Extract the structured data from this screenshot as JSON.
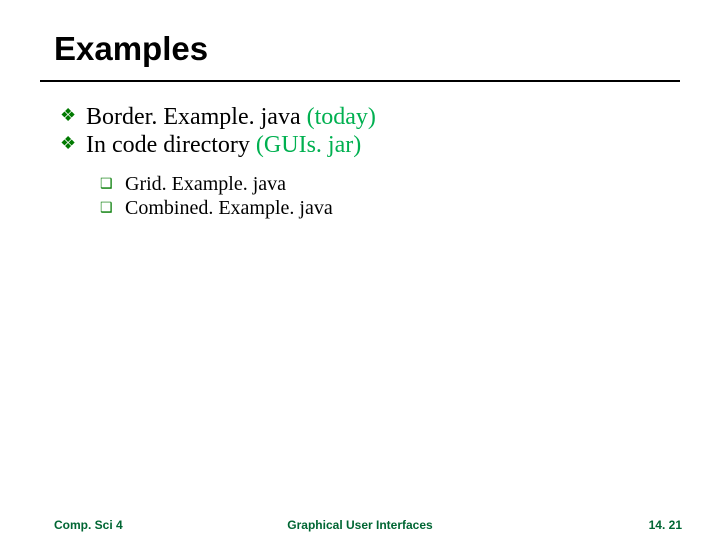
{
  "title": "Examples",
  "bullets": [
    {
      "prefix": "Border. Example. java ",
      "suffix": "(today)"
    },
    {
      "prefix": "In code directory ",
      "suffix": "(GUIs. jar)"
    }
  ],
  "subs": [
    {
      "text": "Grid. Example. java"
    },
    {
      "text": "Combined. Example. java"
    }
  ],
  "footer": {
    "left": "Comp. Sci 4",
    "center": "Graphical User Interfaces",
    "right": "14. 21"
  },
  "marks": {
    "main": "❖",
    "sub": "❑"
  }
}
